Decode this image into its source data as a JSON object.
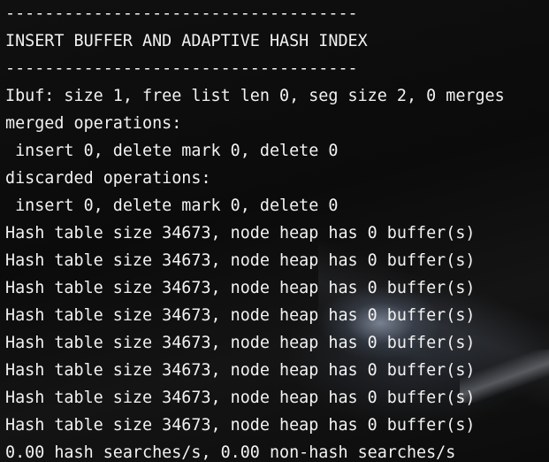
{
  "terminal": {
    "lines": [
      "------------------------------------",
      "INSERT BUFFER AND ADAPTIVE HASH INDEX",
      "------------------------------------",
      "Ibuf: size 1, free list len 0, seg size 2, 0 merges",
      "merged operations:",
      " insert 0, delete mark 0, delete 0",
      "discarded operations:",
      " insert 0, delete mark 0, delete 0",
      "Hash table size 34673, node heap has 0 buffer(s)",
      "Hash table size 34673, node heap has 0 buffer(s)",
      "Hash table size 34673, node heap has 0 buffer(s)",
      "Hash table size 34673, node heap has 0 buffer(s)",
      "Hash table size 34673, node heap has 0 buffer(s)",
      "Hash table size 34673, node heap has 0 buffer(s)",
      "Hash table size 34673, node heap has 0 buffer(s)",
      "Hash table size 34673, node heap has 0 buffer(s)",
      "0.00 hash searches/s, 0.00 non-hash searches/s"
    ]
  }
}
